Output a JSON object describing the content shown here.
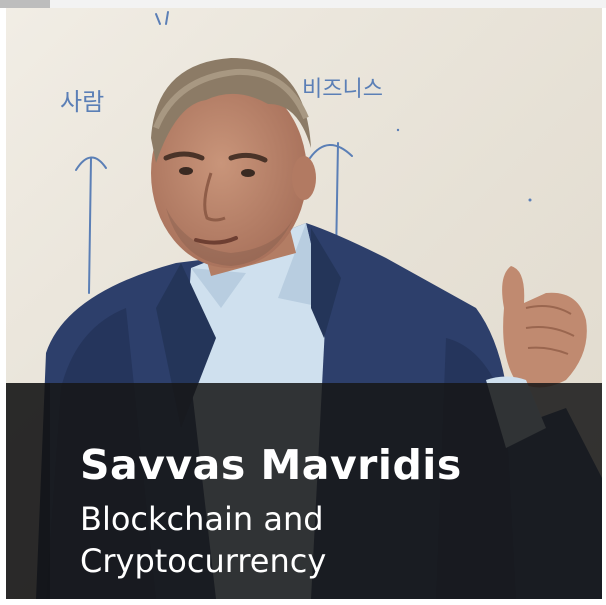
{
  "card": {
    "name": "Savvas Mavridis",
    "subtitle_lines": [
      "Blockchain and",
      "Cryptocurrency"
    ]
  },
  "whiteboard": {
    "left_word": "사람",
    "right_word": "비즈니스"
  },
  "colors": {
    "caption_bg": "#161616",
    "caption_text": "#ffffff",
    "whiteboard": "#ece7dc",
    "marker_blue": "#5b7fb6",
    "jacket": "#2d3f6b",
    "shirt": "#cfe0ee"
  }
}
